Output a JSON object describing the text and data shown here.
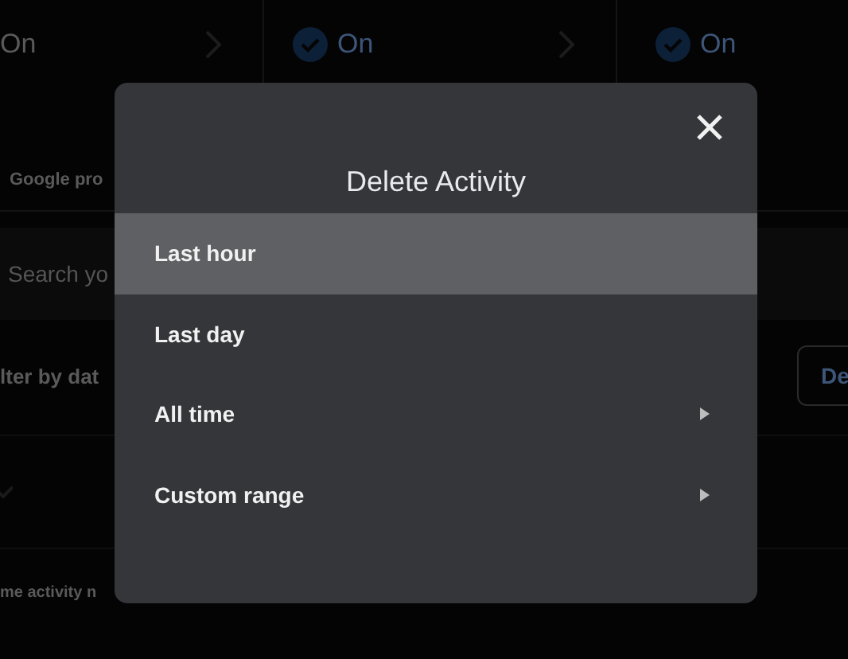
{
  "background": {
    "setting_cards": [
      {
        "status": "On",
        "check_shown": false,
        "chevron": true
      },
      {
        "status": "On",
        "check_shown": true,
        "chevron": true
      },
      {
        "status": "On",
        "check_shown": true,
        "chevron": false
      }
    ],
    "chip": "Google pro",
    "search": {
      "placeholder": "Search yo"
    },
    "filter": "lter by dat",
    "delete_button": "De",
    "footer_text": "me activity n"
  },
  "dialog": {
    "title": "Delete Activity",
    "items": [
      {
        "label": "Last hour",
        "selected": true,
        "submenu": false
      },
      {
        "label": "Last day",
        "selected": false,
        "submenu": false
      },
      {
        "label": "All time",
        "selected": false,
        "submenu": true
      },
      {
        "label": "Custom range",
        "selected": false,
        "submenu": true
      }
    ]
  }
}
